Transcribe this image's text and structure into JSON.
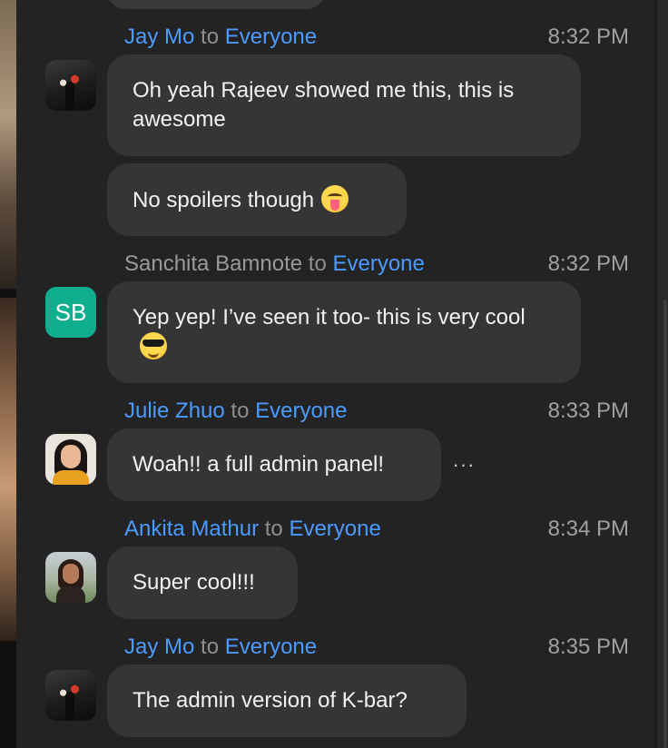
{
  "chat": {
    "recipient_word": "to",
    "recipient": "Everyone",
    "messages": [
      {
        "sender": "Jay Mo",
        "time": "8:32 PM",
        "bubbles": [
          "Oh yeah Rajeev showed me this, this is awesome",
          "No spoilers though"
        ],
        "avatar": "jay-avatar-photo"
      },
      {
        "sender": "Sanchita Bamnote",
        "time": "8:32 PM",
        "initials": "SB",
        "avatar_color": "#0fae8f",
        "bubbles": [
          "Yep yep! I’ve seen it too- this is very cool"
        ]
      },
      {
        "sender": "Julie Zhuo",
        "time": "8:33 PM",
        "bubbles": [
          "Woah!! a full admin panel!"
        ],
        "more_icon": "more-options-icon",
        "more_glyph": "···"
      },
      {
        "sender": "Ankita Mathur",
        "time": "8:34 PM",
        "bubbles": [
          "Super cool!!!"
        ]
      },
      {
        "sender": "Jay Mo",
        "time": "8:35 PM",
        "bubbles": [
          "The admin version of K-bar?"
        ]
      }
    ]
  },
  "colors": {
    "background": "#232323",
    "bubble": "#353535",
    "sender_blue": "#4b9bff",
    "sender_grey": "#9a9a9a",
    "time": "#a0a0a0"
  },
  "icons": {
    "tongue_emoji": "tongue-out-emoji-icon",
    "sunglasses_emoji": "sunglasses-emoji-icon"
  }
}
